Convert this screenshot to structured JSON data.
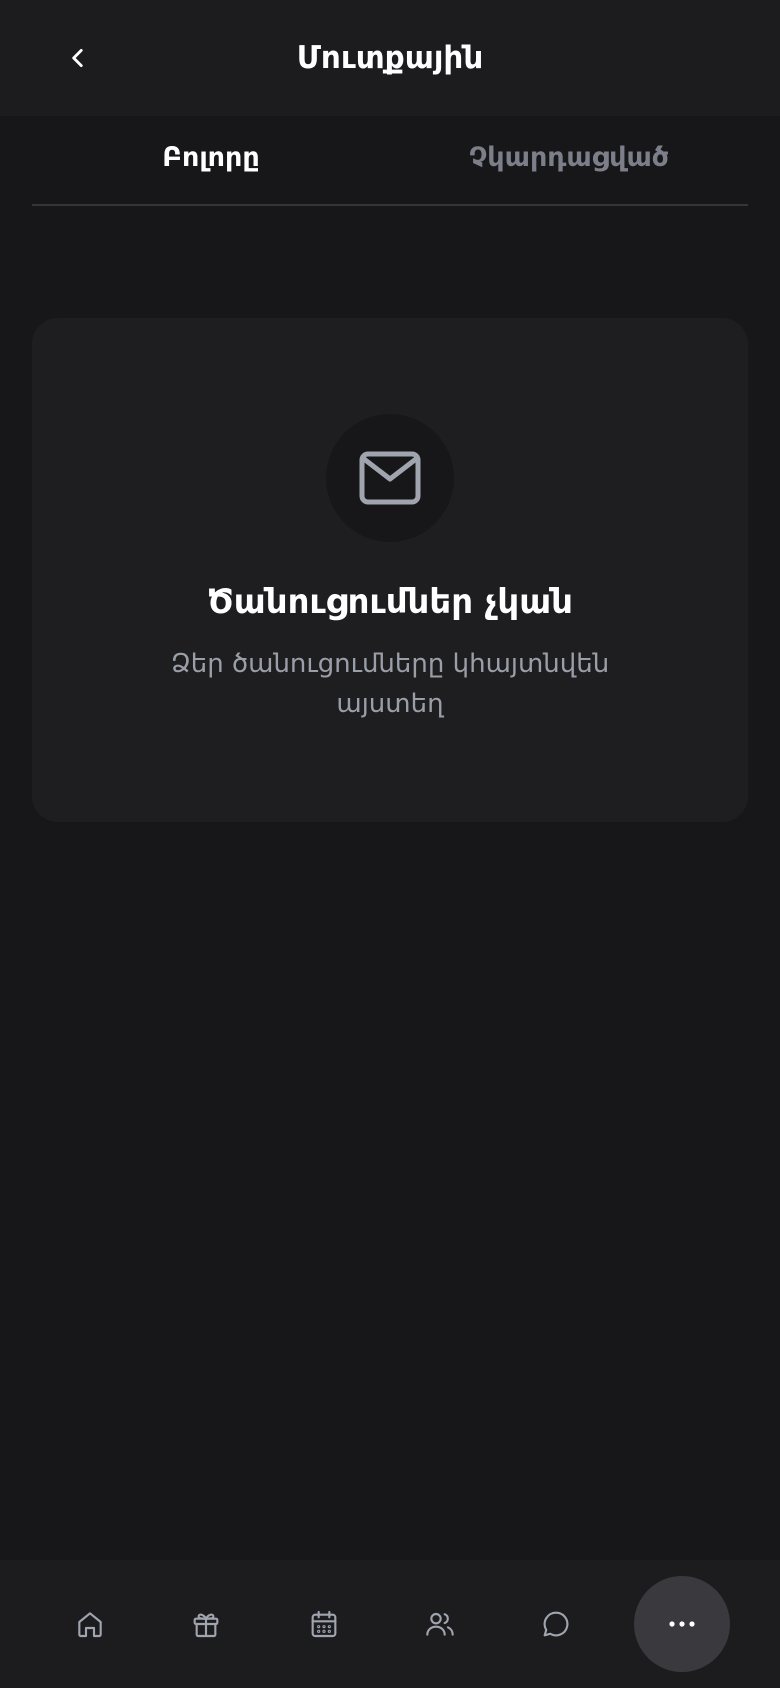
{
  "header": {
    "title": "Մուտքային",
    "back_icon": "chevron-left-icon"
  },
  "tabs": [
    {
      "label": "Բոլորը",
      "active": true
    },
    {
      "label": "Չկարդացված",
      "active": false
    }
  ],
  "empty_state": {
    "icon": "mail-icon",
    "title": "Ծանուցումներ չկան",
    "description": "Ձեր ծանուցումները կհայտնվեն այստեղ"
  },
  "bottom_nav": {
    "items": [
      {
        "icon": "home-icon"
      },
      {
        "icon": "gift-icon"
      },
      {
        "icon": "calendar-icon"
      },
      {
        "icon": "users-icon"
      },
      {
        "icon": "chat-icon"
      },
      {
        "icon": "more-icon"
      }
    ]
  },
  "colors": {
    "background": "#17171a",
    "surface": "#1e1e21",
    "icon_muted": "#a0a4ae",
    "text_muted": "#9a9ea8",
    "tab_inactive": "#7c7f89"
  }
}
